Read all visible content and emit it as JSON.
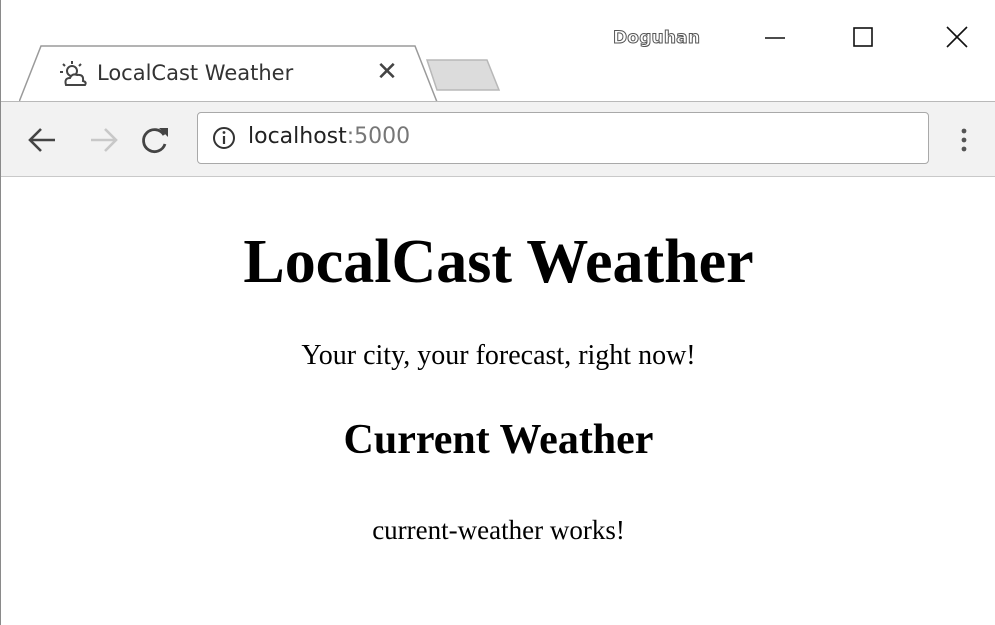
{
  "browser": {
    "profile_name": "Doguhan",
    "tab": {
      "title": "LocalCast Weather",
      "icon": "weather-partly-cloudy-icon",
      "close_glyph": "✕"
    },
    "address_bar": {
      "info_icon": "info-icon",
      "host": "localhost",
      "port": ":5000"
    },
    "window_controls": [
      "minimize",
      "maximize",
      "close"
    ],
    "nav": [
      "back",
      "forward",
      "reload"
    ]
  },
  "page": {
    "title": "LocalCast Weather",
    "tagline": "Your city, your forecast, right now!",
    "section_heading": "Current Weather",
    "component_text": "current-weather works!"
  }
}
